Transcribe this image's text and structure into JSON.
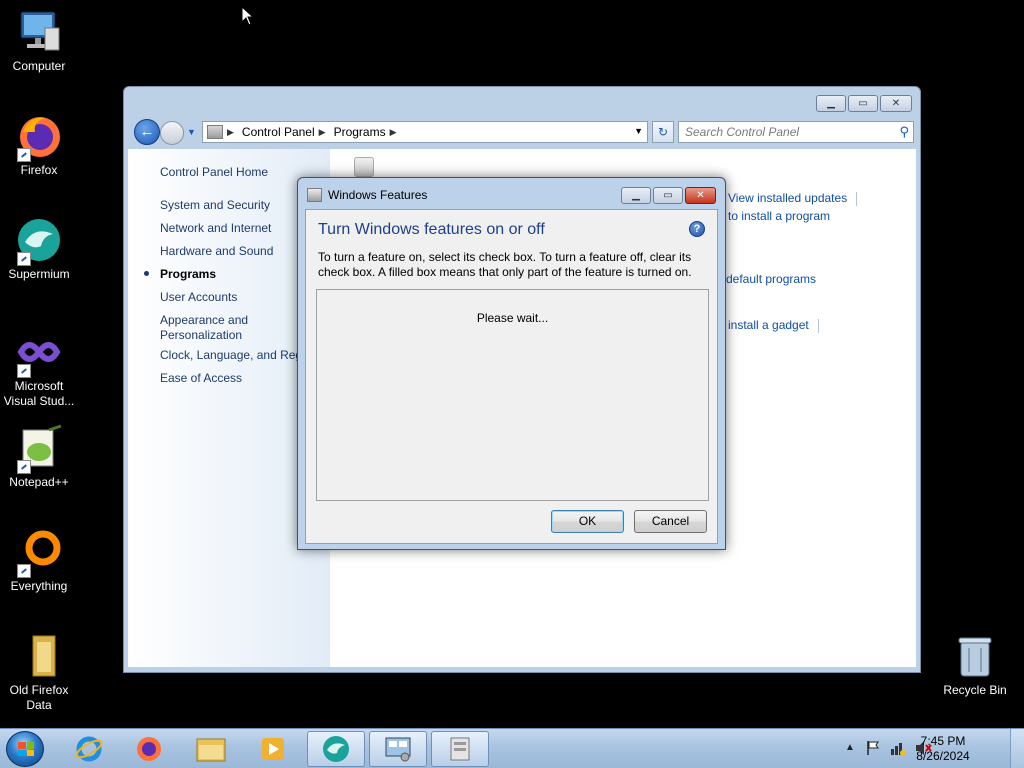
{
  "desktop": {
    "icons": [
      {
        "label": "Computer"
      },
      {
        "label": "Firefox"
      },
      {
        "label": "Supermium"
      },
      {
        "label": "Microsoft Visual Stud..."
      },
      {
        "label": "Notepad++"
      },
      {
        "label": "Everything"
      },
      {
        "label": "Old Firefox Data"
      },
      {
        "label": "Recycle Bin"
      }
    ]
  },
  "control_panel": {
    "breadcrumb": [
      "Control Panel",
      "Programs"
    ],
    "search_placeholder": "Search Control Panel",
    "sidebar": {
      "home": "Control Panel Home",
      "items": [
        {
          "label": "System and Security"
        },
        {
          "label": "Network and Internet"
        },
        {
          "label": "Hardware and Sound"
        },
        {
          "label": "Programs",
          "active": true
        },
        {
          "label": "User Accounts"
        },
        {
          "label": "Appearance and Personalization"
        },
        {
          "label": "Clock, Language, and Reg"
        },
        {
          "label": "Ease of Access"
        }
      ]
    },
    "content_links": {
      "view_updates": "View installed updates",
      "install_program": "to install a program",
      "default_programs": "default programs",
      "install_gadget": "install a gadget"
    }
  },
  "dialog": {
    "title": "Windows Features",
    "heading": "Turn Windows features on or off",
    "description": "To turn a feature on, select its check box. To turn a feature off, clear its check box. A filled box means that only part of the feature is turned on.",
    "status": "Please wait...",
    "ok_label": "OK",
    "cancel_label": "Cancel",
    "help_glyph": "?"
  },
  "taskbar": {
    "pinned": [
      "start-button",
      "internet-explorer",
      "firefox",
      "windows-explorer",
      "media-player",
      "supermium",
      "control-panel",
      "windows-features"
    ],
    "clock_time": "7:45 PM",
    "clock_date": "8/26/2024"
  },
  "colors": {
    "desktop_bg": "#000000",
    "link": "#0f4ea8",
    "heading": "#1e3f8c",
    "taskbar": "#a9c3e0"
  }
}
